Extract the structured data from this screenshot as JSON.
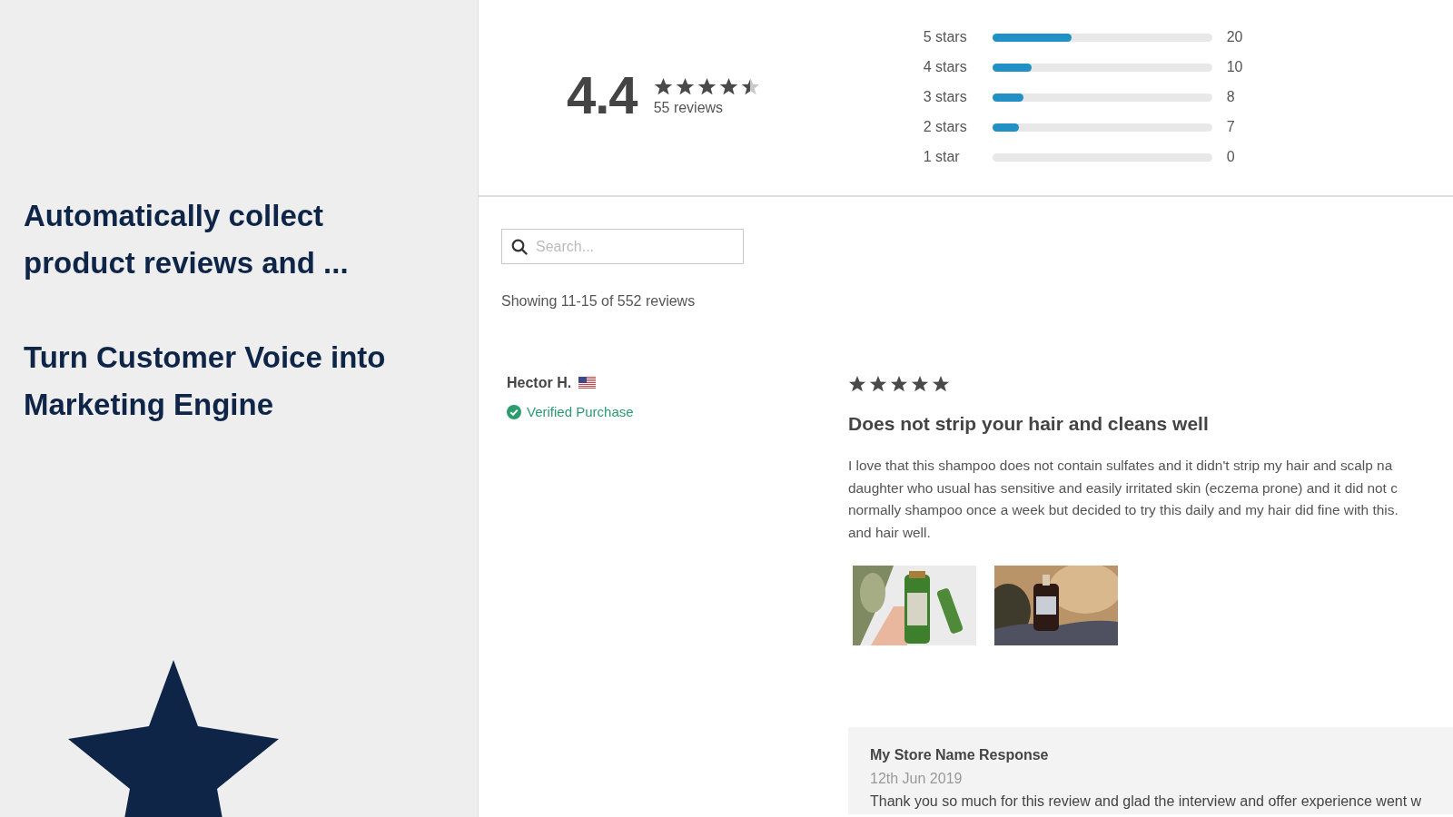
{
  "promo": {
    "headlines": [
      "Automatically collect product reviews and ...",
      "Turn Customer Voice into Marketing Engine"
    ]
  },
  "summary": {
    "average": "4.4",
    "stars": 4.5,
    "review_count": "55 reviews",
    "histogram": [
      {
        "label": "5 stars",
        "level": 0.36,
        "count": "20"
      },
      {
        "label": "4 stars",
        "level": 0.18,
        "count": "10"
      },
      {
        "label": "3 stars",
        "level": 0.14,
        "count": "8"
      },
      {
        "label": "2 stars",
        "level": 0.12,
        "count": "7"
      },
      {
        "label": "1 star",
        "level": 0,
        "count": "0"
      }
    ]
  },
  "search": {
    "placeholder": "Search..."
  },
  "showing": "Showing 11-15 of 552 reviews",
  "reviews": [
    {
      "author": "Hector H.",
      "verified": "Verified Purchase",
      "stars": 5,
      "title": "Does not strip your hair and cleans well",
      "body_lines": [
        "I love that this shampoo does not contain sulfates and it didn't strip my hair and scalp na",
        "daughter who usual has sensitive and easily irritated skin (eczema prone) and it did not c",
        "normally shampoo once a week but decided to try this daily and my hair did fine with this.",
        "and hair well."
      ],
      "photos": [
        {
          "kind": "picture"
        },
        {
          "kind": "picture"
        }
      ],
      "response": {
        "title": "My Store Name Response",
        "date": "12th Jun 2019",
        "text": "Thank you so much for this review and glad the interview and offer experience went w"
      }
    }
  ]
}
